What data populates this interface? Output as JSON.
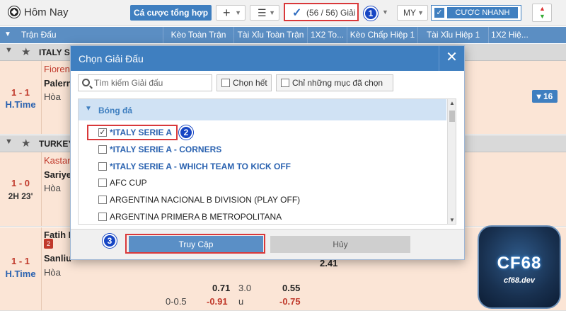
{
  "toolbar": {
    "title": "Hôm Nay",
    "bet_summary_label": "Cá cược tổng hợp",
    "add_icon": "+",
    "league_count": "(56 / 56) Giải",
    "odds_format": "MY",
    "quick_bet_label": "CƯỢC NHANH"
  },
  "table_headers": [
    "Trận Đấu",
    "Kèo Toàn Trận",
    "Tài Xỉu Toàn Trận",
    "1X2 To...",
    "Kèo Chấp Hiệp 1",
    "Tài Xỉu Hiệp 1",
    "1X2 Hiệ..."
  ],
  "leagues": [
    {
      "name": "ITALY S",
      "matches": [
        {
          "score": "1 - 1",
          "time": "H.Time",
          "home": "Fioren",
          "away": "Palern",
          "draw": "Hòa"
        }
      ]
    },
    {
      "name": "TURKEY",
      "matches": [
        {
          "score": "1 - 0",
          "time": "2H 23'",
          "home": "Kastan",
          "away": "Sariye",
          "draw": "Hòa"
        },
        {
          "score": "1 - 1",
          "time": "H.Time",
          "home": "Fatih K",
          "away": "Sanliu",
          "draw": "Hòa"
        }
      ]
    }
  ],
  "more_markets": "▾ 16",
  "odds": {
    "r1_a": "2.41",
    "r2_a": "0.71",
    "r2_b": "3.0",
    "r2_c": "0.55",
    "r3_a": "0-0.5",
    "r3_b": "-0.91",
    "r3_c": "u",
    "r3_d": "-0.75"
  },
  "modal": {
    "title": "Chọn Giải Đấu",
    "close": "✕",
    "search_placeholder": "Tìm kiếm Giải đấu",
    "select_all": "Chọn hết",
    "only_selected": "Chỉ những mục đã chọn",
    "group": "Bóng đá",
    "items": [
      {
        "label": "*ITALY SERIE A",
        "checked": "✓"
      },
      {
        "label": "*ITALY SERIE A - CORNERS",
        "checked": ""
      },
      {
        "label": "*ITALY SERIE A - WHICH TEAM TO KICK OFF",
        "checked": ""
      },
      {
        "label": "AFC CUP",
        "checked": ""
      },
      {
        "label": "ARGENTINA NACIONAL B DIVISION (PLAY OFF)",
        "checked": ""
      },
      {
        "label": "ARGENTINA PRIMERA B METROPOLITANA",
        "checked": ""
      }
    ],
    "confirm": "Truy Cập",
    "cancel": "Hủy"
  },
  "steps": [
    "1",
    "2",
    "3"
  ],
  "logo": {
    "brand": "CF68",
    "domain": "cf68.dev"
  },
  "colors": {
    "primary": "#3f7fc0",
    "highlight": "#d9383a",
    "step_badge": "#1746c4"
  }
}
